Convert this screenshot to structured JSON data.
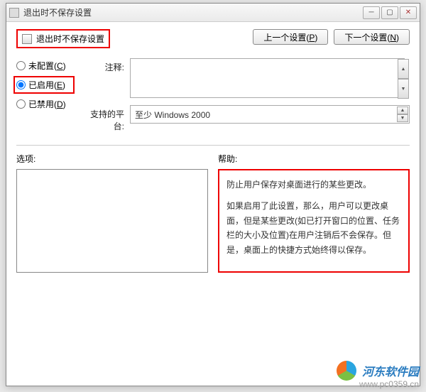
{
  "window": {
    "title": "退出时不保存设置"
  },
  "policy": {
    "title": "退出时不保存设置"
  },
  "nav": {
    "prev": "上一个设置(P)",
    "next": "下一个设置(N)"
  },
  "radios": {
    "not_configured": "未配置(C)",
    "enabled": "已启用(E)",
    "disabled": "已禁用(D)",
    "selected": "enabled"
  },
  "fields": {
    "comment_label": "注释:",
    "comment_value": "",
    "platform_label": "支持的平台:",
    "platform_value": "至少 Windows 2000"
  },
  "sections": {
    "options_label": "选项:",
    "help_label": "帮助:"
  },
  "help": {
    "p1": "防止用户保存对桌面进行的某些更改。",
    "p2": "如果启用了此设置，那么，用户可以更改桌面，但是某些更改(如已打开窗口的位置、任务栏的大小及位置)在用户注销后不会保存。但是，桌面上的快捷方式始终得以保存。"
  },
  "watermark": {
    "brand": "河东软件园",
    "url": "www.pc0359.cn"
  }
}
